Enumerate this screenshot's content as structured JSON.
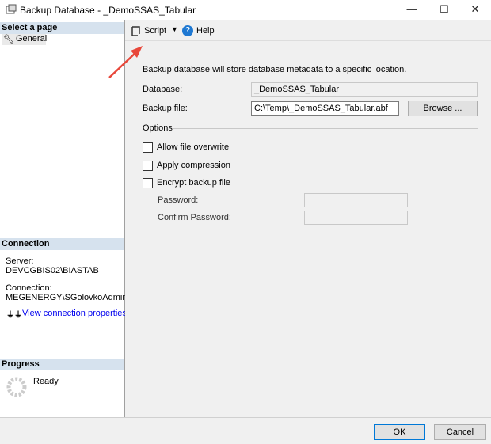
{
  "window": {
    "title": "Backup Database - _DemoSSAS_Tabular",
    "minimize": "—",
    "maximize": "☐",
    "close": "✕"
  },
  "left": {
    "select_page_header": "Select a page",
    "pages": [
      {
        "label": "General"
      }
    ],
    "connection_header": "Connection",
    "server_label": "Server:",
    "server_value": "DEVCGBIS02\\BIASTAB",
    "connection_label": "Connection:",
    "connection_value": "MEGENERGY\\SGolovkoAdmin",
    "view_link": "View connection properties",
    "progress_header": "Progress",
    "progress_status": "Ready"
  },
  "toolbar": {
    "script": "Script",
    "help": "Help"
  },
  "main": {
    "description": "Backup database will store database metadata to a specific location.",
    "database_label": "Database:",
    "database_value": "_DemoSSAS_Tabular",
    "backup_file_label": "Backup file:",
    "backup_file_value": "C:\\Temp\\_DemoSSAS_Tabular.abf",
    "browse": "Browse ...",
    "options_label": "Options",
    "options": [
      {
        "label": "Allow file overwrite",
        "checked": false
      },
      {
        "label": "Apply compression",
        "checked": false
      },
      {
        "label": "Encrypt backup file",
        "checked": false
      }
    ],
    "password_label": "Password:",
    "password_value": "",
    "confirm_label": "Confirm Password:",
    "confirm_value": ""
  },
  "footer": {
    "ok": "OK",
    "cancel": "Cancel"
  },
  "colors": {
    "section_header": "#d6e2ee",
    "arrow": "#e8473a",
    "link": "#0000ee"
  }
}
